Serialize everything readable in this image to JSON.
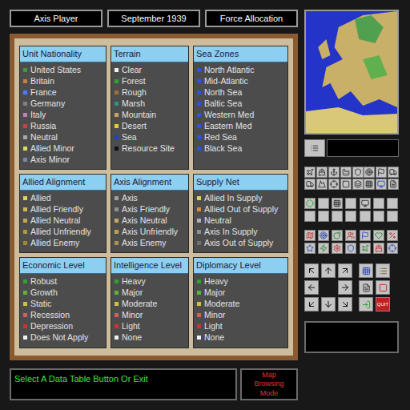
{
  "header": {
    "player": "Axis Player",
    "date": "September 1939",
    "phase": "Force Allocation"
  },
  "panels": [
    {
      "title": "Unit Nationality",
      "items": [
        {
          "label": "United States",
          "color": "#3c9a3c"
        },
        {
          "label": "Britain",
          "color": "#c08040"
        },
        {
          "label": "France",
          "color": "#4a80ff"
        },
        {
          "label": "Germany",
          "color": "#808080"
        },
        {
          "label": "Italy",
          "color": "#c080c0"
        },
        {
          "label": "Russia",
          "color": "#c84040"
        },
        {
          "label": "Neutral",
          "color": "#a8a8a8"
        },
        {
          "label": "Allied Minor",
          "color": "#e0d860"
        },
        {
          "label": "Axis Minor",
          "color": "#7888a8"
        }
      ]
    },
    {
      "title": "Terrain",
      "items": [
        {
          "label": "Clear",
          "color": "#f0f0f0"
        },
        {
          "label": "Forest",
          "color": "#30a030"
        },
        {
          "label": "Rough",
          "color": "#a07040"
        },
        {
          "label": "Marsh",
          "color": "#309090"
        },
        {
          "label": "Mountain",
          "color": "#c8a060"
        },
        {
          "label": "Desert",
          "color": "#e0d040"
        },
        {
          "label": "Sea",
          "color": "#2040d0"
        },
        {
          "label": "Resource Site",
          "color": "#101010"
        }
      ]
    },
    {
      "title": "Sea Zones",
      "items": [
        {
          "label": "North Atlantic",
          "color": "#3050e0"
        },
        {
          "label": "Mid-Atlantic",
          "color": "#3050e0"
        },
        {
          "label": "North Sea",
          "color": "#3050e0"
        },
        {
          "label": "Baltic Sea",
          "color": "#3050e0"
        },
        {
          "label": "Western Med",
          "color": "#3050e0"
        },
        {
          "label": "Eastern Med",
          "color": "#3050e0"
        },
        {
          "label": "Red Sea",
          "color": "#3050e0"
        },
        {
          "label": "Black Sea",
          "color": "#3050e0"
        }
      ]
    },
    {
      "title": "Allied Alignment",
      "items": [
        {
          "label": "Allied",
          "color": "#e0d060"
        },
        {
          "label": "Allied Friendly",
          "color": "#d0b850"
        },
        {
          "label": "Allied Neutral",
          "color": "#c0a848"
        },
        {
          "label": "Allied Unfriendly",
          "color": "#b09840"
        },
        {
          "label": "Allied Enemy",
          "color": "#a08838"
        }
      ]
    },
    {
      "title": "Axis Alignment",
      "items": [
        {
          "label": "Axis",
          "color": "#a0a0a0"
        },
        {
          "label": "Axis Friendly",
          "color": "#909090"
        },
        {
          "label": "Axis Neutral",
          "color": "#c8a860"
        },
        {
          "label": "Axis Unfriendly",
          "color": "#c0a050"
        },
        {
          "label": "Axis Enemy",
          "color": "#b09048"
        }
      ]
    },
    {
      "title": "Supply Net",
      "items": [
        {
          "label": "Allied In Supply",
          "color": "#e0d060"
        },
        {
          "label": "Allied Out of Supply",
          "color": "#d09040"
        },
        {
          "label": "Neutral",
          "color": "#b0b0b0"
        },
        {
          "label": "Axis In Supply",
          "color": "#909090"
        },
        {
          "label": "Axis Out of Supply",
          "color": "#707070"
        }
      ]
    },
    {
      "title": "Economic Level",
      "items": [
        {
          "label": "Robust",
          "color": "#30a030"
        },
        {
          "label": "Growth",
          "color": "#60b040"
        },
        {
          "label": "Static",
          "color": "#d0c040"
        },
        {
          "label": "Recession",
          "color": "#d06060"
        },
        {
          "label": "Depression",
          "color": "#d03030"
        },
        {
          "label": "Does Not Apply",
          "color": "#f0f0f0"
        }
      ]
    },
    {
      "title": "Intelligence Level",
      "items": [
        {
          "label": "Heavy",
          "color": "#30a030"
        },
        {
          "label": "Major",
          "color": "#60b040"
        },
        {
          "label": "Moderate",
          "color": "#d0c040"
        },
        {
          "label": "Minor",
          "color": "#d06060"
        },
        {
          "label": "Light",
          "color": "#d03030"
        },
        {
          "label": "None",
          "color": "#f0f0f0"
        }
      ]
    },
    {
      "title": "Diplomacy Level",
      "items": [
        {
          "label": "Heavy",
          "color": "#30a030"
        },
        {
          "label": "Major",
          "color": "#60b040"
        },
        {
          "label": "Moderate",
          "color": "#d0c040"
        },
        {
          "label": "Minor",
          "color": "#d06060"
        },
        {
          "label": "Light",
          "color": "#d03030"
        },
        {
          "label": "None",
          "color": "#f0f0f0"
        }
      ]
    }
  ],
  "status_bar": {
    "message": "Select A Data Table Button Or Exit",
    "mode": "Map Browsing Mode"
  },
  "quit_label": "QUIT"
}
